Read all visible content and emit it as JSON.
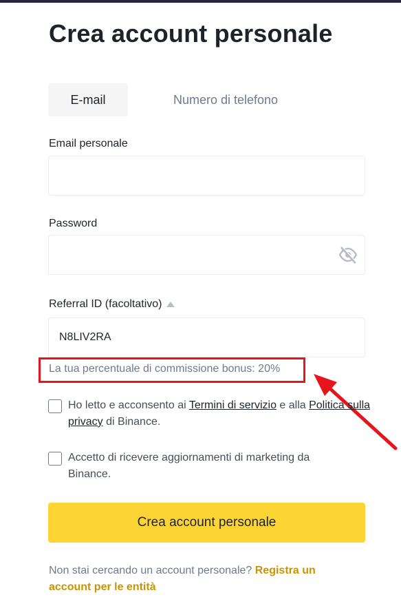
{
  "page": {
    "title": "Crea account personale"
  },
  "tabs": [
    {
      "label": "E-mail",
      "active": true
    },
    {
      "label": "Numero di telefono",
      "active": false
    }
  ],
  "form": {
    "email": {
      "label": "Email personale",
      "value": "",
      "placeholder": ""
    },
    "password": {
      "label": "Password",
      "value": "",
      "placeholder": "",
      "icon": "eye-hidden-icon"
    },
    "referral": {
      "label": "Referral ID (facoltativo)",
      "value": "N8LIV2RA",
      "icon": "caret-up-icon"
    },
    "bonus_text": "La tua percentuale di commissione bonus: 20%",
    "terms": {
      "prefix": "Ho letto e acconsento ai ",
      "link1": "Termini di servizio",
      "middle": " e alla ",
      "link2": "Politica sulla privacy",
      "suffix": " di Binance.",
      "checked": false
    },
    "marketing": {
      "text": "Accetto di ricevere aggiornamenti di marketing da Binance.",
      "checked": false
    },
    "submit_label": "Crea account personale"
  },
  "footer": {
    "text": "Non stai cercando un account personale? ",
    "link": "Registra un account per le entità"
  },
  "colors": {
    "accent": "#fcd535",
    "link": "#c99400",
    "highlight": "#e8141b",
    "muted": "#707a8a",
    "border": "#eaecef"
  }
}
